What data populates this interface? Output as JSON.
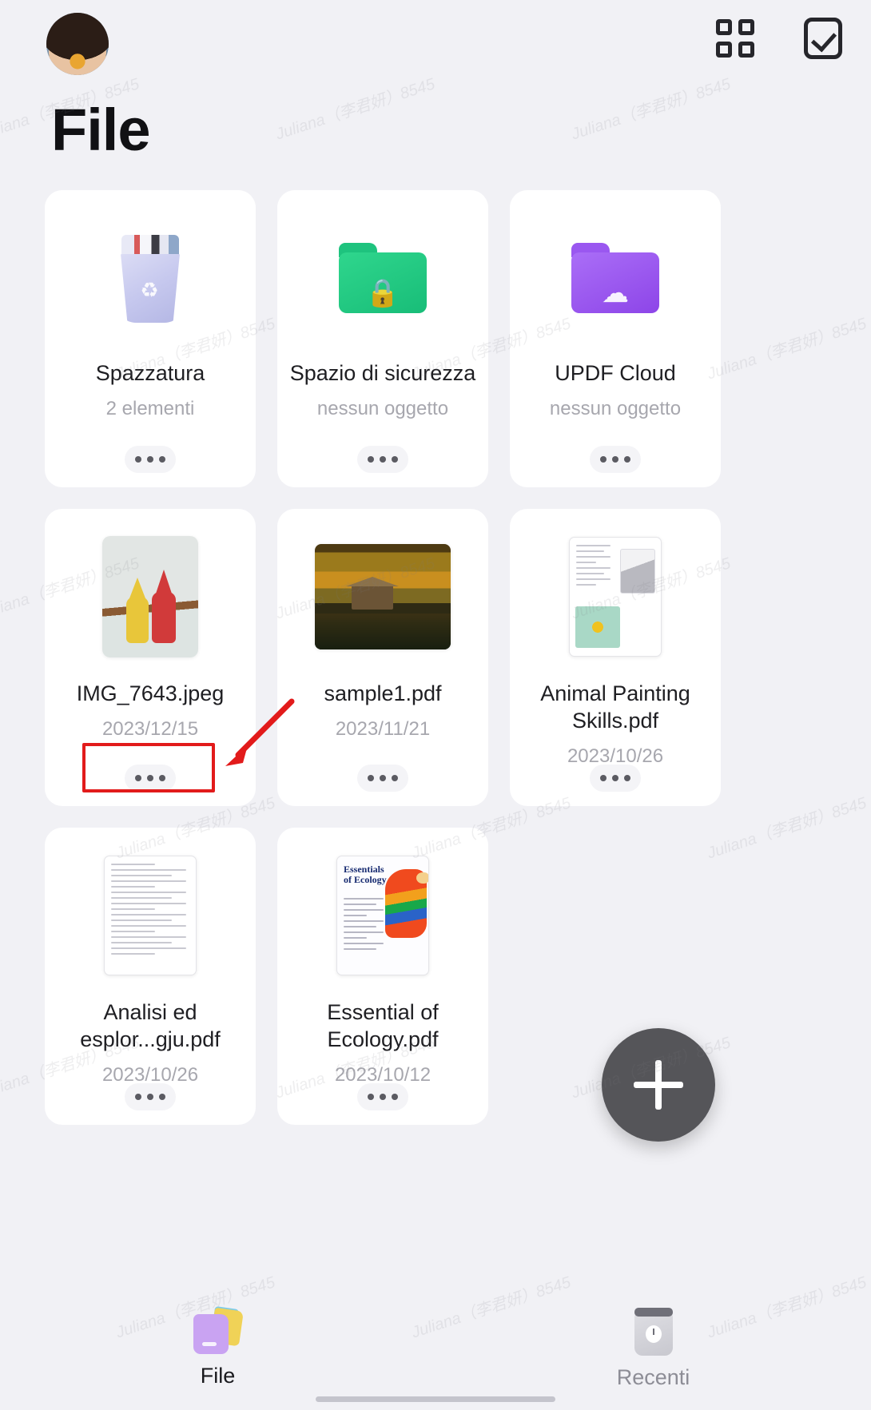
{
  "header": {
    "title": "File",
    "avatar_name": "user-avatar",
    "grid_view_icon": "grid-view-icon",
    "select_icon": "select-all-check-icon"
  },
  "cards": [
    {
      "name": "Spazzatura",
      "sub": "2 elementi",
      "thumb": "trash-bin-icon",
      "menu": "more-options"
    },
    {
      "name": "Spazio di sicurezza",
      "sub": "nessun oggetto",
      "thumb": "secure-folder-icon",
      "menu": "more-options"
    },
    {
      "name": "UPDF Cloud",
      "sub": "nessun oggetto",
      "thumb": "cloud-folder-icon",
      "menu": "more-options"
    },
    {
      "name": "IMG_7643.jpeg",
      "sub": "2023/12/15",
      "thumb": "image-thumbnail-cats",
      "menu": "more-options"
    },
    {
      "name": "sample1.pdf",
      "sub": "2023/11/21",
      "thumb": "image-thumbnail-autumn",
      "menu": "more-options"
    },
    {
      "name": "Animal Painting Skills.pdf",
      "sub": "2023/10/26",
      "thumb": "document-thumbnail-animal",
      "menu": "more-options"
    },
    {
      "name": "Analisi ed esplor...gju.pdf",
      "sub": "2023/10/26",
      "thumb": "document-thumbnail-outline",
      "menu": "more-options"
    },
    {
      "name": "Essential of Ecology.pdf",
      "sub": "2023/10/12",
      "thumb": "document-thumbnail-ecology",
      "menu": "more-options"
    }
  ],
  "ecology_thumb": {
    "title_line1": "Essentials",
    "title_line2": "of Ecology"
  },
  "fab": {
    "icon": "plus-icon",
    "label": "+"
  },
  "bottom_nav": {
    "items": [
      {
        "label": "File",
        "icon": "folder-icon",
        "active": true
      },
      {
        "label": "Recenti",
        "icon": "clock-icon",
        "active": false
      }
    ]
  },
  "annotation": {
    "highlight_target": "more-options-button-img-7643",
    "color": "#e21b1b"
  },
  "watermarks": [
    "Juliana（李君妍）8545",
    "Juliana（李君妍）8545",
    "Juliana（李君妍）8545",
    "Juliana（李君妍）8545",
    "Juliana（李君妍）8545",
    "Juliana（李君妍）8545",
    "Juliana（李君妍）8545",
    "Juliana（李君妍）8545",
    "Juliana（李君妍）8545",
    "Juliana（李君妍）8545",
    "Juliana（李君妍）8545",
    "Juliana（李君妍）8545",
    "Juliana（李君妍）8545",
    "Juliana（李君妍）8545",
    "Juliana（李君妍）8545",
    "Juliana（李君妍）8545",
    "Juliana（李君妍）8545",
    "Juliana（李君妍）8545"
  ]
}
